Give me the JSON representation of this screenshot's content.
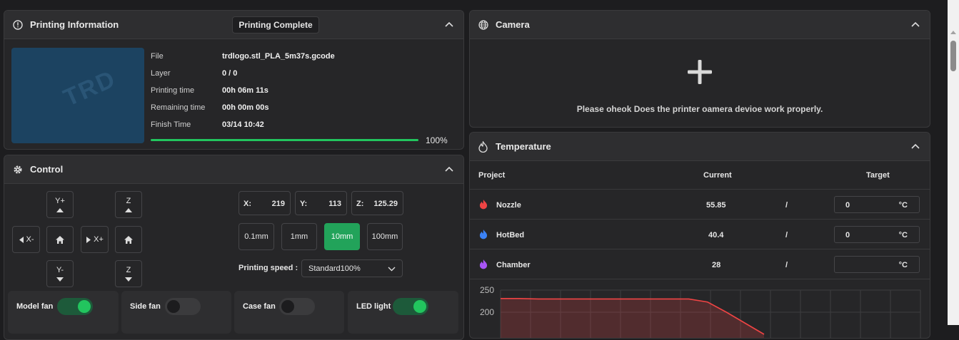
{
  "printing_info": {
    "title": "Printing Information",
    "status": "Printing Complete",
    "fields": [
      {
        "label": "File",
        "value": "trdlogo.stl_PLA_5m37s.gcode"
      },
      {
        "label": "Layer",
        "value": "0 / 0"
      },
      {
        "label": "Printing time",
        "value": "00h 06m 11s"
      },
      {
        "label": "Remaining time",
        "value": "00h 00m 00s"
      },
      {
        "label": "Finish Time",
        "value": "03/14 10:42"
      }
    ],
    "progress_text": "100%",
    "progress_fraction": 1.0,
    "thumbnail_text": "TRD"
  },
  "control": {
    "title": "Control",
    "jog": {
      "y_plus": "Y+",
      "y_minus": "Y-",
      "x_minus": "X-",
      "x_plus": "X+",
      "z_up": "Z",
      "z_down": "Z"
    },
    "coords": {
      "x_label": "X:",
      "x": "219",
      "y_label": "Y:",
      "y": "113",
      "z_label": "Z:",
      "z": "125.29"
    },
    "steps": [
      "0.1mm",
      "1mm",
      "10mm",
      "100mm"
    ],
    "active_step": "10mm",
    "speed_label": "Printing speed :",
    "speed_value": "Standard100%",
    "fans": [
      {
        "label": "Model fan",
        "on": true
      },
      {
        "label": "Side fan",
        "on": false
      },
      {
        "label": "Case fan",
        "on": false
      },
      {
        "label": "LED light",
        "on": true
      }
    ]
  },
  "camera": {
    "title": "Camera",
    "message": "Please oheok Does the printer oamera devioe work properly."
  },
  "temperature": {
    "title": "Temperature",
    "headers": {
      "project": "Project",
      "current": "Current",
      "target": "Target"
    },
    "rows": [
      {
        "name": "Nozzle",
        "current": "55.85",
        "sep": "/",
        "target": "0",
        "unit": "°C",
        "color": "#ef4444"
      },
      {
        "name": "HotBed",
        "current": "40.4",
        "sep": "/",
        "target": "0",
        "unit": "°C",
        "color": "#3b82f6"
      },
      {
        "name": "Chamber",
        "current": "28",
        "sep": "/",
        "target": "",
        "unit": "°C",
        "color": "#a855f7"
      }
    ],
    "chart_data": {
      "type": "area",
      "yticks": [
        250,
        200
      ],
      "ylim": [
        0,
        250
      ],
      "series": [
        {
          "values": [
            231,
            231,
            230,
            230,
            230,
            230,
            230,
            230,
            230,
            230,
            230,
            223,
            200,
            175,
            150
          ]
        }
      ]
    }
  },
  "colors": {
    "accent": "#22c55e",
    "panel": "#262628",
    "header": "#2e2e30"
  }
}
